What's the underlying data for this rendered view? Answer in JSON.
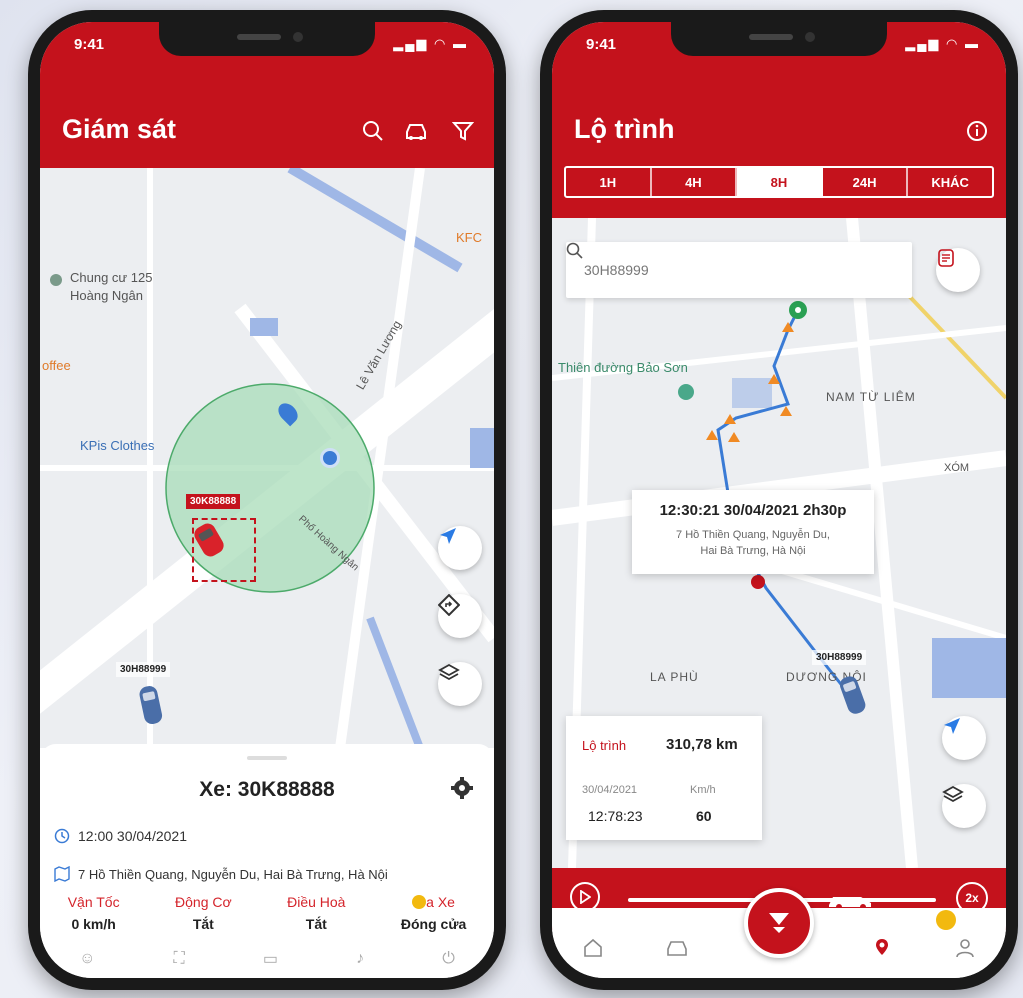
{
  "left_phone": {
    "status_time": "9:41",
    "header_title": "Giám sát",
    "map_labels": {
      "kfc": "KFC",
      "chung_cu": "Chung cư 125",
      "hoang_ngan": "Hoàng Ngân",
      "coffee": "offee",
      "le_van_luong": "Lê Văn Lương",
      "kpis": "KPis Clothes",
      "pho_hoang_ngan": "Phố Hoàng Ngân"
    },
    "selected_plate": "30K88888",
    "other_plate": "30H88999",
    "vehicle_title": "Xe: 30K88888",
    "datetime": "12:00 30/04/2021",
    "address": "7 Hồ Thiền Quang, Nguyễn Du, Hai Bà Trưng, Hà Nội",
    "stats": [
      {
        "label": "Vận Tốc",
        "value": "0 km/h"
      },
      {
        "label": "Động Cơ",
        "value": "Tắt"
      },
      {
        "label": "Điều Hoà",
        "value": "Tắt"
      },
      {
        "label": "a Xe",
        "value": "Đóng cửa"
      }
    ]
  },
  "right_phone": {
    "status_time": "9:41",
    "header_title": "Lộ trình",
    "tabs": [
      {
        "label": "1H"
      },
      {
        "label": "4H"
      },
      {
        "label": "8H",
        "active": true
      },
      {
        "label": "24H"
      },
      {
        "label": "KHÁC"
      }
    ],
    "search_value": "30H88999",
    "map_labels": {
      "thien_duong": "Thiên đường Bảo Sơn",
      "nam_tu_liem": "NAM TỪ LIÊM",
      "xom": "XÓM",
      "la_phu": "LA PHÙ",
      "duong_noi": "DƯƠNG NỘI"
    },
    "tooltip_title": "12:30:21 30/04/2021 2h30p",
    "tooltip_address_1": "7 Hồ Thiền Quang, Nguyễn Du,",
    "tooltip_address_2": "Hai Bà Trưng, Hà Nội",
    "vehicle_plate": "30H88999",
    "route_label": "Lộ trình",
    "route_distance": "310,78 km",
    "date_label": "30/04/2021",
    "speed_unit_label": "Km/h",
    "time_value": "12:78:23",
    "speed_value": "60",
    "speed_multiplier": "2x",
    "playback_progress": 0.72
  },
  "colors": {
    "brand_red": "#c4121c",
    "geofence_green": "#a8dcb8",
    "route_blue": "#3a7bd5",
    "marker_orange": "#f08a24"
  }
}
